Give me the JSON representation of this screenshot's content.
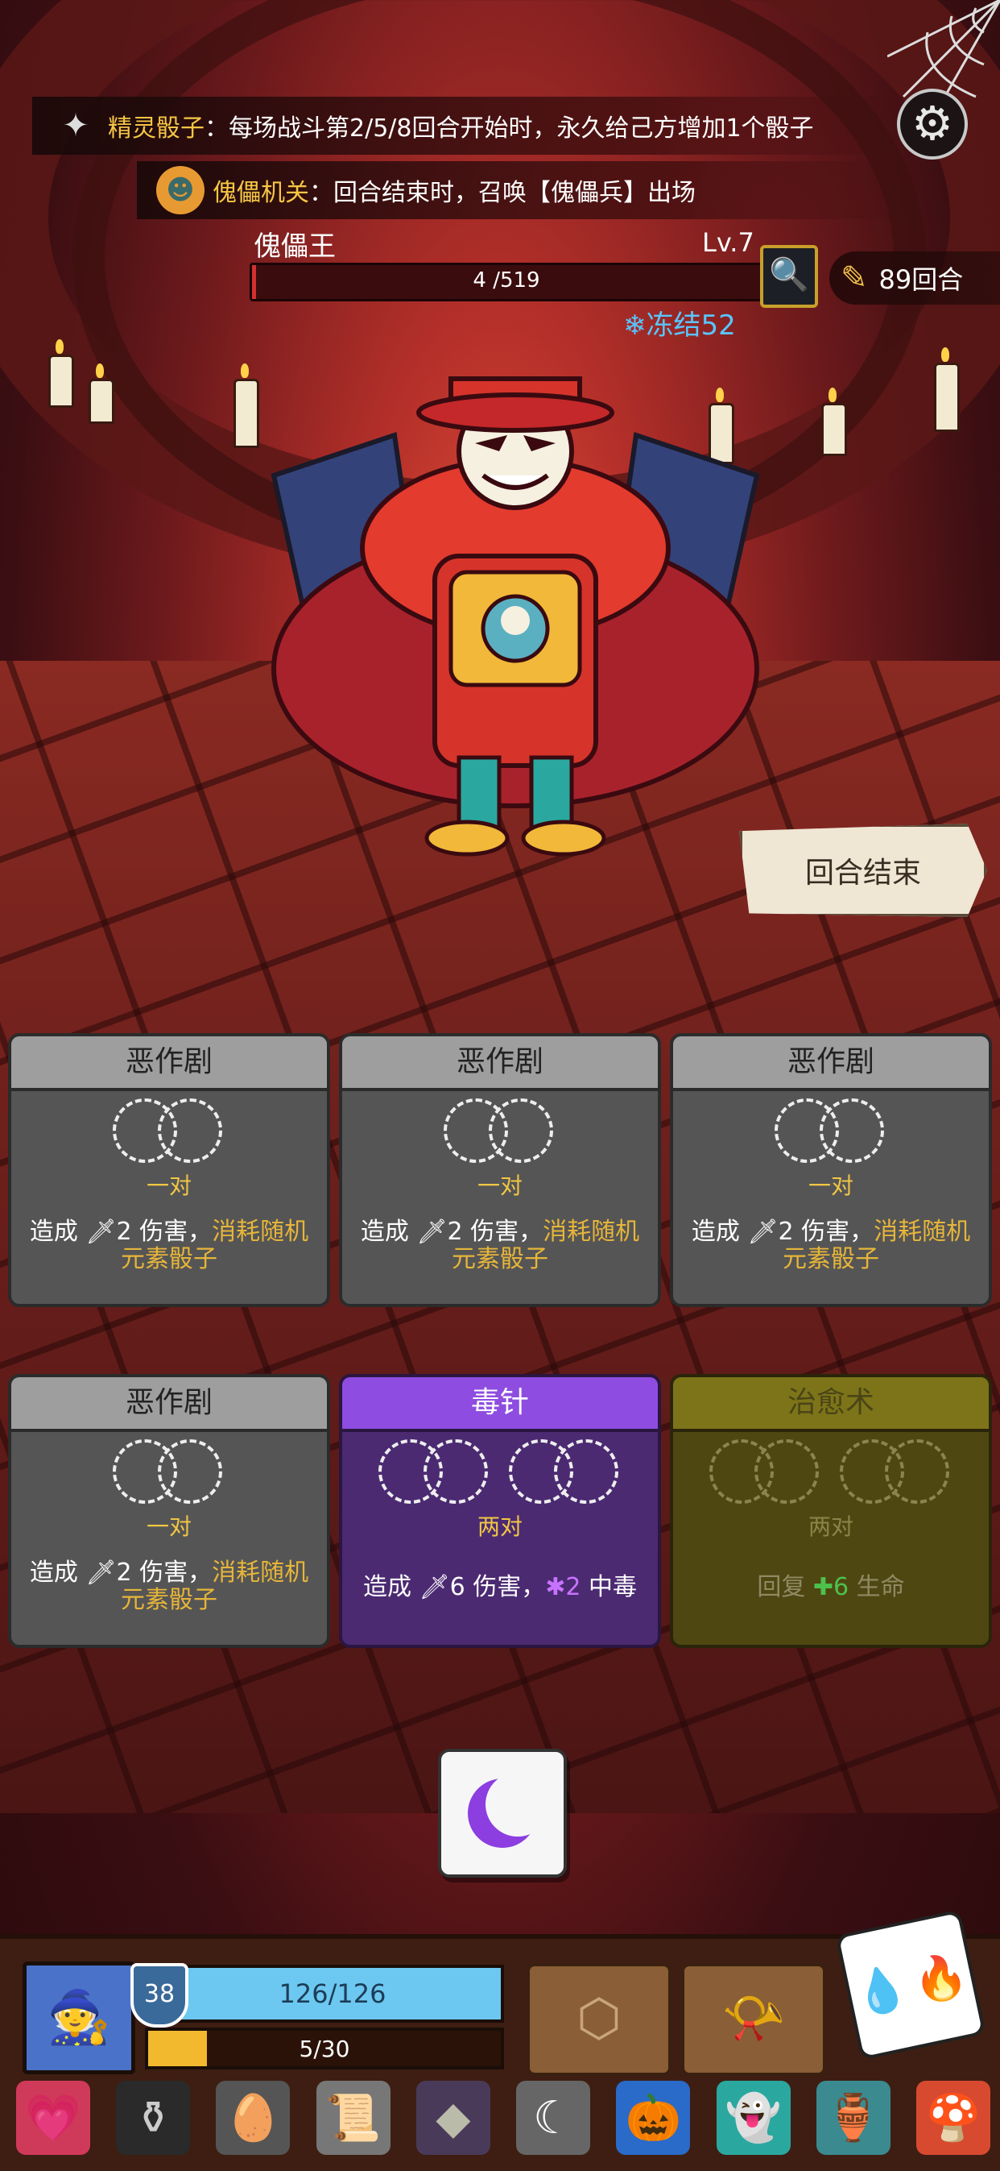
{
  "banners": {
    "b1_name": "精灵骰子",
    "b1_sep": "：",
    "b1_desc": "每场战斗第2/5/8回合开始时，永久给己方增加1个骰子",
    "b2_name": "傀儡机关",
    "b2_sep": "：",
    "b2_desc": "回合结束时，召唤【傀儡兵】出场"
  },
  "boss": {
    "name": "傀儡王",
    "level": "Lv.7",
    "hp_text": "4 /519",
    "hp_current": 4,
    "hp_max": 519,
    "freeze_text": "冻结52"
  },
  "rounds_text": "89回合",
  "end_turn_label": "回合结束",
  "cards": [
    {
      "title": "恶作剧",
      "req": "一对",
      "pre": "造成 ",
      "dmg": "2",
      "mid": " 伤害，",
      "hl1": "消耗随机",
      "hl2": "元素骰子"
    },
    {
      "title": "恶作剧",
      "req": "一对",
      "pre": "造成 ",
      "dmg": "2",
      "mid": " 伤害，",
      "hl1": "消耗随机",
      "hl2": "元素骰子"
    },
    {
      "title": "恶作剧",
      "req": "一对",
      "pre": "造成 ",
      "dmg": "2",
      "mid": " 伤害，",
      "hl1": "消耗随机",
      "hl2": "元素骰子"
    },
    {
      "title": "恶作剧",
      "req": "一对",
      "pre": "造成 ",
      "dmg": "2",
      "mid": " 伤害，",
      "hl1": "消耗随机",
      "hl2": "元素骰子"
    },
    {
      "title": "毒针",
      "req": "两对",
      "pre": "造成 ",
      "dmg": "6",
      "mid": " 伤害，",
      "poison": "2",
      "post": " 中毒"
    },
    {
      "title": "治愈术",
      "req": "两对",
      "pre": "回复 ",
      "heal": "6",
      "post": " 生命"
    }
  ],
  "player": {
    "armor": "38",
    "hp_text": "126/126",
    "hp_fraction": 1.0,
    "xp_text": "5/30",
    "xp_fraction": 0.1667
  },
  "icons": {
    "gear": "gear-icon",
    "moon_die": "moon-icon",
    "freeze": "snowflake-icon"
  },
  "colors": {
    "accent_gold": "#f5c645",
    "poison_purple": "#c873ff",
    "heal_green": "#4cc24c",
    "freeze_blue": "#59c5ff"
  }
}
